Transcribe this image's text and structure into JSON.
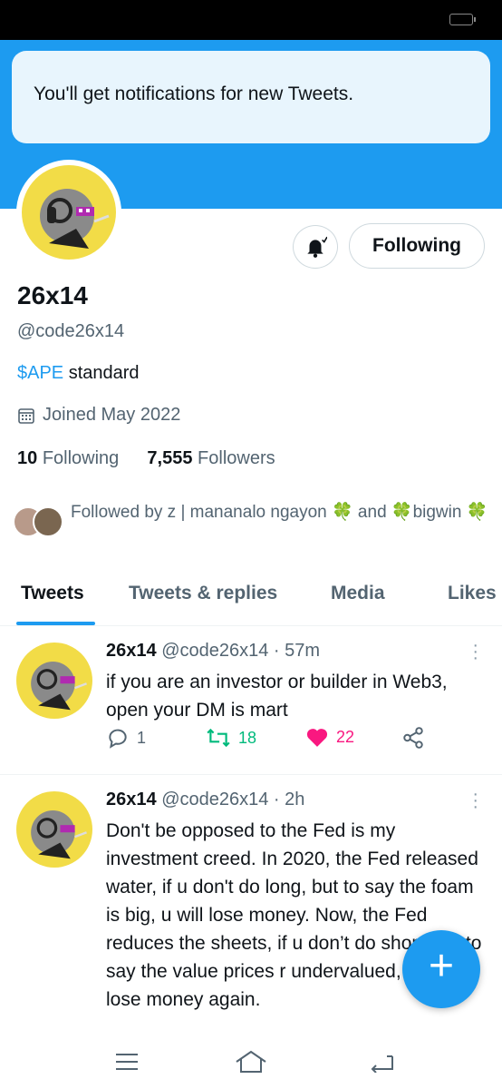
{
  "toast": {
    "message": "You'll get notifications for new Tweets."
  },
  "profile": {
    "name": "26x14",
    "handle": "@code26x14",
    "bio_link": "$APE",
    "bio_rest": " standard",
    "joined": "Joined May 2022",
    "following_count": "10",
    "following_label": "Following",
    "followers_count": "7,555",
    "followers_label": "Followers",
    "follow_button": "Following",
    "followed_by": "Followed by z | mananalo ngayon 🍀 and 🍀bigwin 🍀"
  },
  "tabs": [
    {
      "label": "Tweets"
    },
    {
      "label": "Tweets & replies"
    },
    {
      "label": "Media"
    },
    {
      "label": "Likes"
    }
  ],
  "tweets": [
    {
      "name": "26x14",
      "meta": "@code26x14 · 57m",
      "text": "if you are an investor or builder in Web3, open your DM is mart",
      "replies": "1",
      "retweets": "18",
      "likes": "22"
    },
    {
      "name": "26x14",
      "meta": "@code26x14 · 2h",
      "text": "Don't be opposed to the Fed is my investment creed. In 2020, the Fed released water, if u don't do long, but to say the foam is big, u will lose money. Now, the Fed reduces the sheets, if u don’t do short, but to say the value prices r undervalued, u will lose money again."
    }
  ],
  "colors": {
    "accent": "#1d9bf0",
    "retweet": "#00ba7c",
    "like": "#f91880",
    "avatar_bg": "#f2dc47"
  },
  "icons": [
    "bell-icon",
    "calendar-icon",
    "reply-icon",
    "retweet-icon",
    "heart-icon",
    "share-icon",
    "plus-icon",
    "menu-icon",
    "home-icon",
    "back-icon"
  ]
}
